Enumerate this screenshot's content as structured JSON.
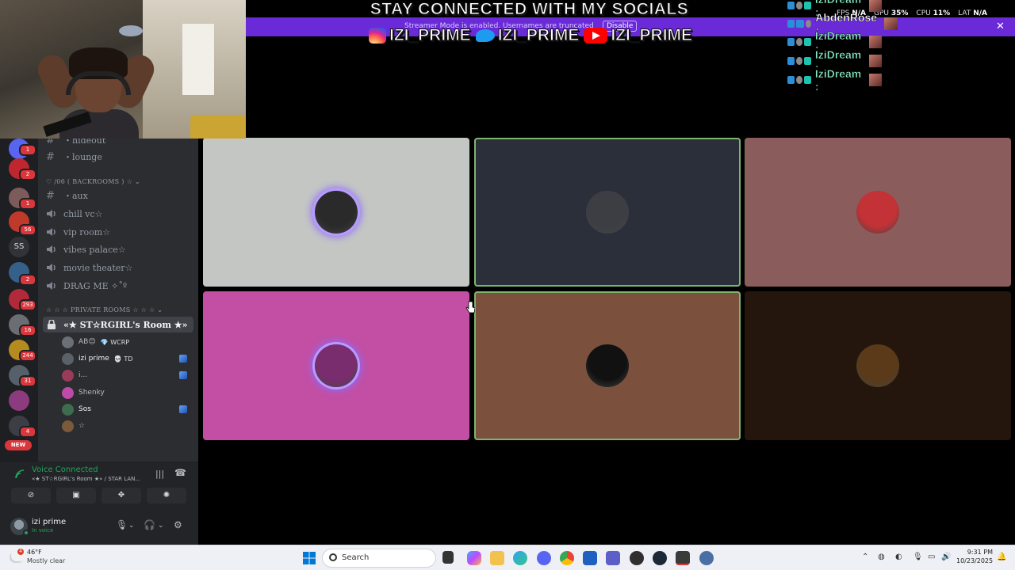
{
  "banner": {
    "title": "STAY CONNECTED WITH MY SOCIALS",
    "notice": "Streamer Mode is enabled. Usernames are truncated",
    "disable_label": "Disable",
    "socials": [
      {
        "icon": "instagram-icon",
        "handle": "IZI_PRIME"
      },
      {
        "icon": "twitter-icon",
        "handle": "IZI_PRIME"
      },
      {
        "icon": "youtube-icon",
        "handle": "IZI_PRIME"
      }
    ]
  },
  "perf": {
    "fps_label": "FPS",
    "fps": "N/A",
    "gpu_label": "GPU",
    "gpu": "35%",
    "cpu_label": "CPU",
    "cpu": "11%",
    "lat_label": "LAT",
    "lat": "N/A"
  },
  "chat": [
    {
      "name": "IziDream :"
    },
    {
      "name": "AbdenRose :"
    },
    {
      "name": "IziDream :"
    },
    {
      "name": "IziDream :"
    },
    {
      "name": "IziDream :"
    }
  ],
  "rail": {
    "badges": [
      "1",
      "2",
      "1",
      "56",
      "2",
      "293",
      "16",
      "244",
      "31",
      "4"
    ],
    "ss_label": "SS",
    "new_label": "NEW"
  },
  "channels": {
    "top": [
      {
        "label": "・hideout",
        "type": "text"
      },
      {
        "label": "・lounge",
        "type": "text"
      }
    ],
    "category_backrooms": "♡ /06 ( BACKROOMS ) ☆ ⌄",
    "backrooms": [
      {
        "label": "・aux",
        "type": "text"
      },
      {
        "label": "chill vc☆",
        "type": "voice"
      },
      {
        "label": "vip room☆",
        "type": "voice"
      },
      {
        "label": "vibes palace☆",
        "type": "voice"
      },
      {
        "label": "movie theater☆",
        "type": "voice"
      },
      {
        "label": "DRAG ME ✧˚º",
        "type": "voice"
      }
    ],
    "category_private": "☆ ☆ ☆ PRIVATE ROOMS ☆ ☆ ☆ ⌄",
    "active_room": "«★ ST☆RGIRL's Room ★»",
    "voice_users": [
      {
        "name": "AB😊",
        "tag": "💎 WCRP",
        "color": "#6b6f76"
      },
      {
        "name": "izi prime",
        "tag": "💀 TD",
        "color": "#5a6168"
      },
      {
        "name": "i...",
        "tag": "",
        "color": "#9b3b5a"
      },
      {
        "name": "Shenky",
        "tag": "",
        "color": "#c04aa8"
      },
      {
        "name": "Sos",
        "tag": "",
        "color": "#3f6b4f"
      },
      {
        "name": "☆",
        "tag": "",
        "color": "#7a5a3a"
      }
    ]
  },
  "voice": {
    "status": "Voice Connected",
    "room": "«★ ST☆RGIRL's Room ★» / STAR LAN...",
    "user_name": "izi prime",
    "user_status": "In voice"
  },
  "tiles": [
    {
      "name": "tile-user-1",
      "bg": "#c4c6c4",
      "avatar": "#2a2a2a",
      "glow": true,
      "speaking": false
    },
    {
      "name": "tile-user-2",
      "bg": "#2a2f3a",
      "avatar": "#3c3e44",
      "glow": false,
      "speaking": true
    },
    {
      "name": "tile-user-3",
      "bg": "#8a5d5c",
      "avatar": "#c23236",
      "glow": false,
      "speaking": false
    },
    {
      "name": "tile-user-4",
      "bg": "#c24fa3",
      "avatar": "#7a2d6e",
      "glow": true,
      "speaking": false
    },
    {
      "name": "tile-user-5",
      "bg": "#7b513d",
      "avatar": "#111111",
      "glow": false,
      "speaking": true
    },
    {
      "name": "tile-user-6",
      "bg": "#24150d",
      "avatar": "#5a3a18",
      "glow": false,
      "speaking": false
    }
  ],
  "taskbar": {
    "weather_temp": "46°F",
    "weather_desc": "Mostly clear",
    "weather_badge": "4",
    "search_label": "Search",
    "time": "9:31 PM",
    "date": "10/23/2025"
  },
  "colors": {
    "accent": "#6a2ad8",
    "voice_green": "#23a55a",
    "speaking": "#7db56f"
  }
}
